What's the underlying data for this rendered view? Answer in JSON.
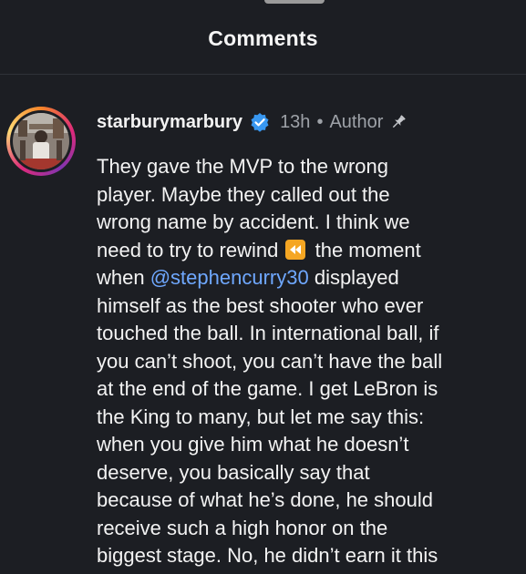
{
  "sheet": {
    "title": "Comments"
  },
  "comment": {
    "username": "starburymarbury",
    "verified": true,
    "timestamp": "13h",
    "separator": "•",
    "author_label": "Author",
    "avatar_icon": "profile-photo",
    "verified_icon": "verified-badge-icon",
    "pin_icon": "pin-icon",
    "colors": {
      "mention": "#6fa8ff",
      "verified": "#3897f0",
      "rewind_emoji": "#f5a623"
    },
    "lines": [
      "They gave the MVP to the wrong",
      "player. Maybe they called out the",
      "wrong name by accident. I think we",
      "need to try to rewind",
      "the moment",
      "when",
      "@stephencurry30",
      "displayed",
      "himself as the best shooter who ever",
      "touched the ball. In international ball, if",
      "you can’t shoot, you can’t have the ball",
      "at the end of the game. I get LeBron is",
      "the King to many, but let me say this:",
      "when you give him what he doesn’t",
      "deserve, you basically say that",
      "because of what he’s done, he should",
      "receive such a high honor on the",
      "biggest stage. No, he didn’t earn it this"
    ],
    "emoji": "rewind-emoji"
  }
}
